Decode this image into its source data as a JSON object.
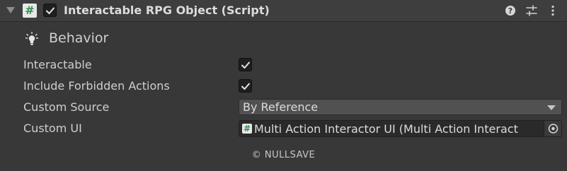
{
  "header": {
    "title": "Interactable RPG Object (Script)",
    "enabled": true,
    "script_icon_glyph": "#",
    "icons": [
      "foldout-arrow-icon",
      "script-icon",
      "help-icon",
      "presets-icon",
      "more-options-icon"
    ]
  },
  "section": {
    "title": "Behavior",
    "icon": "lightbulb-icon"
  },
  "fields": {
    "interactable": {
      "label": "Interactable",
      "checked": true
    },
    "include_forbidden": {
      "label": "Include Forbidden Actions",
      "checked": true
    },
    "custom_source": {
      "label": "Custom Source",
      "value": "By Reference"
    },
    "custom_ui": {
      "label": "Custom UI",
      "value": "Multi Action Interactor UI (Multi Action Interact",
      "icon_glyph": "#"
    }
  },
  "footer": {
    "text": "© NULLSAVE"
  },
  "colors": {
    "background": "#383838",
    "header": "#3e3e3e",
    "script_icon_green": "#2f8f4f"
  }
}
